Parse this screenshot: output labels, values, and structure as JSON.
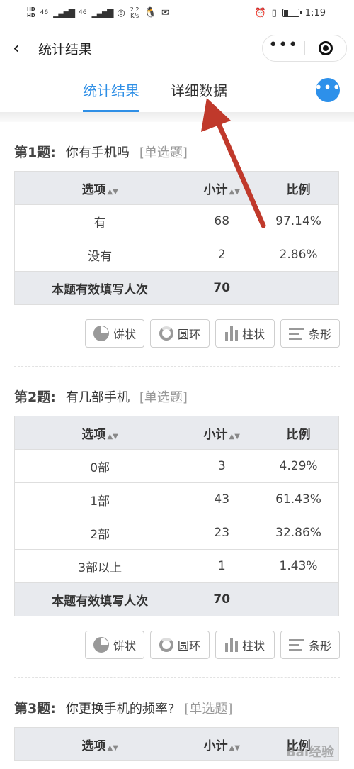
{
  "status_bar": {
    "hd_top": "HD",
    "hd_bottom": "HD",
    "network_left": "46",
    "network_right": "46",
    "speed_value": "2.2",
    "speed_unit": "K/s",
    "time": "1:19"
  },
  "nav": {
    "title": "统计结果"
  },
  "tabs": [
    {
      "label": "统计结果",
      "active": true
    },
    {
      "label": "详细数据",
      "active": false
    }
  ],
  "columns": {
    "option": "选项",
    "count": "小计",
    "ratio": "比例"
  },
  "chart_buttons": {
    "pie": "饼状",
    "ring": "圆环",
    "bar": "柱状",
    "hbar": "条形"
  },
  "questions": [
    {
      "num": "第1题:",
      "title": "你有手机吗",
      "type": "[单选题]",
      "rows": [
        {
          "option": "有",
          "count": "68",
          "ratio": "97.14%"
        },
        {
          "option": "没有",
          "count": "2",
          "ratio": "2.86%"
        }
      ],
      "total_label": "本题有效填写人次",
      "total_value": "70"
    },
    {
      "num": "第2题:",
      "title": "有几部手机",
      "type": "[单选题]",
      "rows": [
        {
          "option": "0部",
          "count": "3",
          "ratio": "4.29%"
        },
        {
          "option": "1部",
          "count": "43",
          "ratio": "61.43%"
        },
        {
          "option": "2部",
          "count": "23",
          "ratio": "32.86%"
        },
        {
          "option": "3部以上",
          "count": "1",
          "ratio": "1.43%"
        }
      ],
      "total_label": "本题有效填写人次",
      "total_value": "70"
    },
    {
      "num": "第3题:",
      "title": "你更换手机的频率?",
      "type": "[单选题]"
    }
  ],
  "watermark": "Bai经验",
  "colors": {
    "accent": "#2f8fe6",
    "arrow": "#c0392b",
    "header_bg": "#e8eaee"
  }
}
